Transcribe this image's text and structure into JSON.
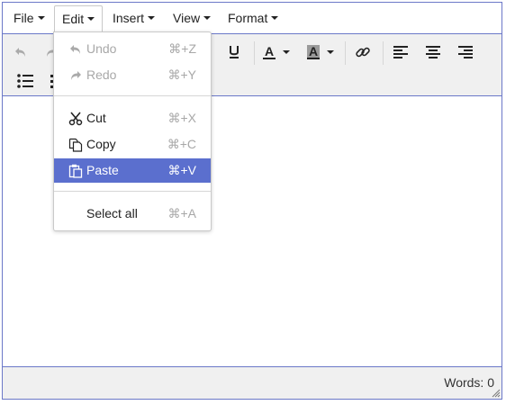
{
  "menubar": {
    "items": [
      {
        "label": "File"
      },
      {
        "label": "Edit"
      },
      {
        "label": "Insert"
      },
      {
        "label": "View"
      },
      {
        "label": "Format"
      }
    ]
  },
  "edit_menu": {
    "undo": {
      "label": "Undo",
      "shortcut": "⌘+Z",
      "state": "disabled",
      "icon": "undo-icon"
    },
    "redo": {
      "label": "Redo",
      "shortcut": "⌘+Y",
      "state": "disabled",
      "icon": "redo-icon"
    },
    "cut": {
      "label": "Cut",
      "shortcut": "⌘+X",
      "state": "enabled",
      "icon": "scissors-icon"
    },
    "copy": {
      "label": "Copy",
      "shortcut": "⌘+C",
      "state": "enabled",
      "icon": "copy-icon"
    },
    "paste": {
      "label": "Paste",
      "shortcut": "⌘+V",
      "state": "highlighted",
      "icon": "paste-icon"
    },
    "select_all": {
      "label": "Select all",
      "shortcut": "⌘+A",
      "state": "enabled"
    }
  },
  "toolbar": {
    "text_color_label": "A",
    "background_color_label": "A"
  },
  "status": {
    "word_count": "Words: 0"
  },
  "colors": {
    "accent": "#5b6fce",
    "border": "#6b78c8",
    "toolbar_bg": "#f0f0f0"
  }
}
